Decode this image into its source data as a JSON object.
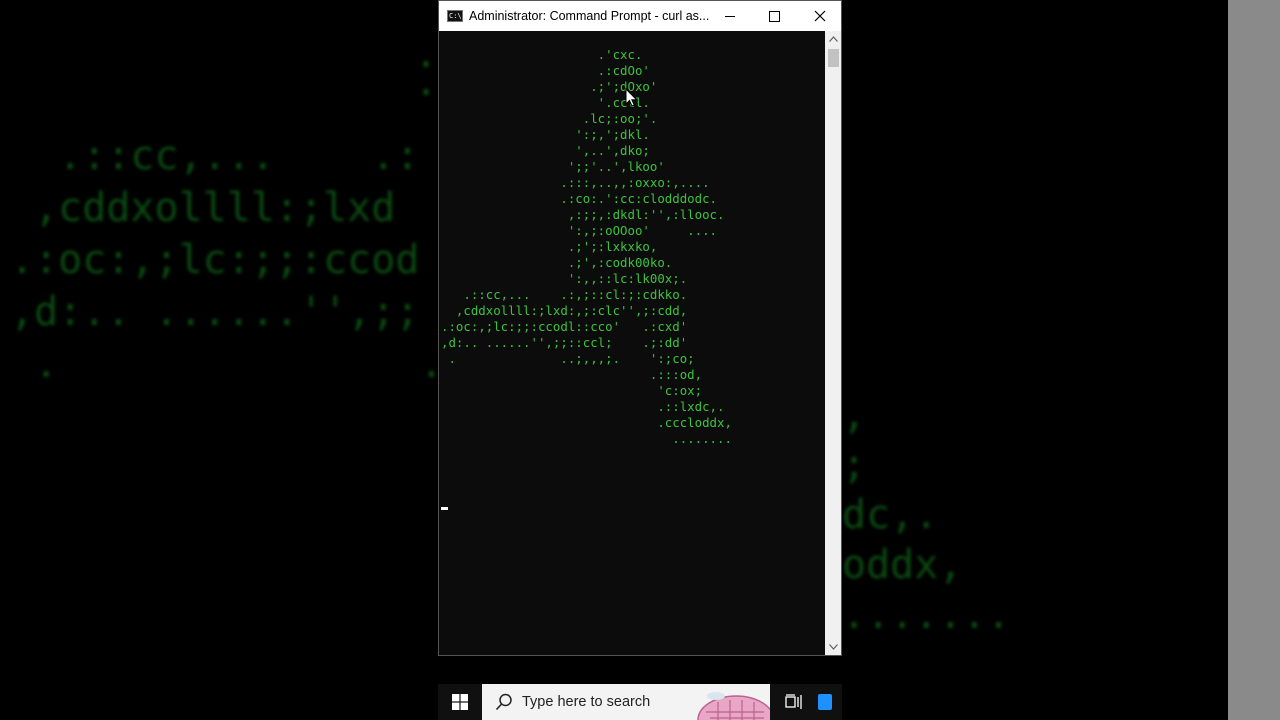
{
  "window": {
    "title": "Administrator: Command Prompt - curl  as..."
  },
  "console": {
    "ascii_art": "                     .'cxc.\n                     .:cdOo'\n                    .;';dOxo'\n                     '.ccll.\n                   .lc;:oo;'.\n                  ':;,';dkl.\n                  ',..',dko;\n                 ';;'..',lkoo'\n                .:::,..,,:oxxo:,....\n                .:co:.':cc:clodddodc.\n                 ,:;;,:dkdl:'',:llooc.\n                 ':,;:oOOoo'     ....\n                 .;';:lxkxko,\n                 .;',:codk00ko.\n                 ':,,::lc:lk00x;.\n   .::cc,...    .:,;::cl:;:cdkko.\n  ,cddxollll:;lxd:,;:clc'',;:cdd,\n.:oc:,;lc:;;:ccodl::cco'   .:cxd'\n,d:.. ......'',;;::ccl;    .;:dd'\n .              ..;,,,;.    ':;co;\n                            .:::od,\n                             'c:ox;\n                             .::lxdc,.\n                             .cccloddx,\n                               ........"
  },
  "background": {
    "left_art": "  .::cc,...    .:\n ,cddxollll:;lxd\n.:oc:,;lc:;;:ccod\n,d:.. ......'',;;\n .               .",
    "right_art": ",\n;\ndc,.\noddx,\n.......",
    "left_dots": ".\n."
  },
  "taskbar": {
    "search_placeholder": "Type here to search"
  },
  "icons": {
    "app": "command-prompt-icon",
    "minimize": "minimize-icon",
    "maximize": "maximize-icon",
    "close": "close-icon",
    "start": "windows-logo-icon",
    "search": "search-icon",
    "task_view": "task-view-icon",
    "pointer": "mouse-pointer-icon"
  },
  "colors": {
    "console_text": "#3cc33c",
    "console_bg": "#0c0c0c",
    "accent": "#0078d7"
  }
}
